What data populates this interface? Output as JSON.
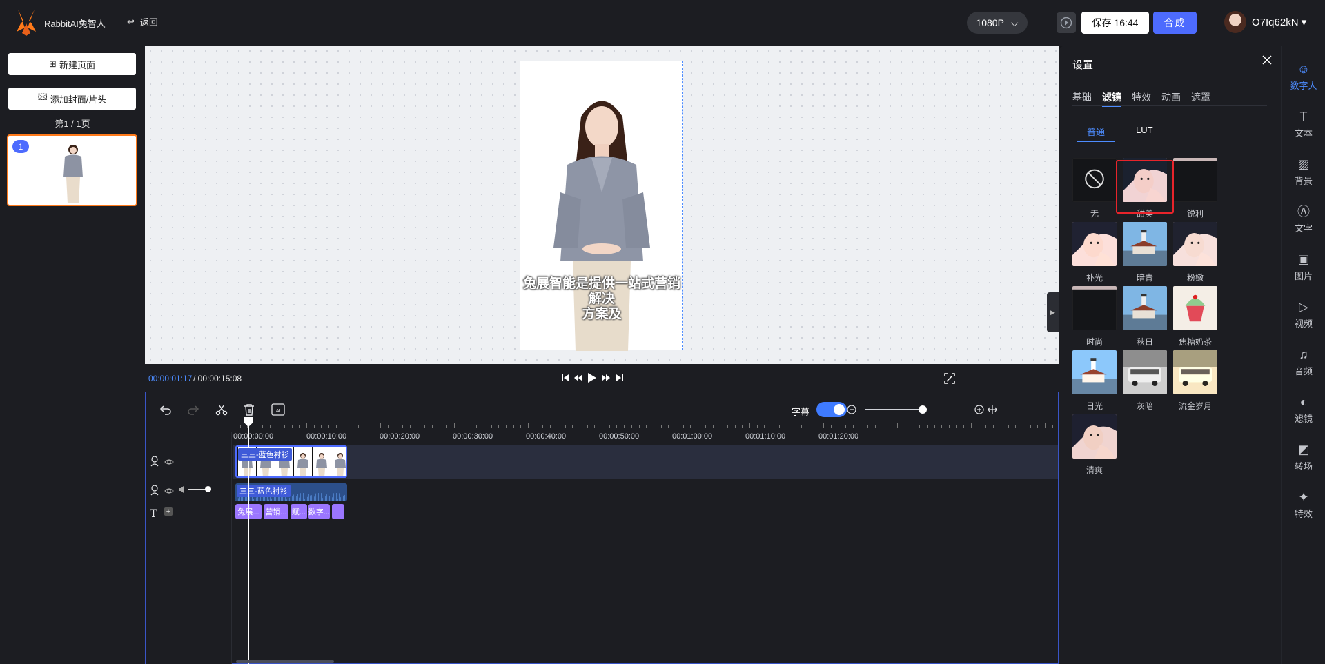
{
  "app": {
    "name": "RabbitAI兔智人",
    "back_label": "返回"
  },
  "topbar": {
    "resolution": "1080P",
    "save_label": "保存 16:44",
    "compose_label": "合成",
    "username": "O7Iq62kN"
  },
  "left": {
    "new_page": "新建页面",
    "add_cover": "添加封面/片头",
    "page_count": "第1 / 1页",
    "page_badge": "1"
  },
  "canvas": {
    "subtitle_line1": "兔展智能是提供一站式营销解决",
    "subtitle_line2": "方案及"
  },
  "player": {
    "current_time": "00:00:01:17",
    "total_time": "/ 00:00:15:08"
  },
  "timeline": {
    "subtitle_toggle_label": "字幕",
    "subtitle_enabled": true,
    "zoom_level": 1.0,
    "ticks": [
      "00:00:00:00",
      "00:00:10:00",
      "00:00:20:00",
      "00:00:30:00",
      "00:00:40:00",
      "00:00:50:00",
      "00:01:00:00",
      "00:01:10:00",
      "00:01:20:00"
    ],
    "video_clip_label": "三三-蓝色衬衫",
    "audio_clip_label": "三三-蓝色衬衫",
    "subtitle_clips": [
      "兔展...",
      "营销...",
      "赋...",
      "数字...",
      ""
    ]
  },
  "settings": {
    "title": "设置",
    "tabs": [
      "基础",
      "滤镜",
      "特效",
      "动画",
      "遮罩"
    ],
    "active_tab": "滤镜",
    "subtabs": [
      "普通",
      "LUT"
    ],
    "active_subtab": "普通",
    "filters": [
      "无",
      "甜美",
      "锐利",
      "补光",
      "暗青",
      "粉嫩",
      "时尚",
      "秋日",
      "焦糖奶茶",
      "日光",
      "灰暗",
      "流金岁月",
      "清爽"
    ],
    "selected_filter": "甜美"
  },
  "rail": [
    "数字人",
    "文本",
    "背景",
    "文字",
    "图片",
    "视频",
    "音频",
    "滤镜",
    "转场",
    "特效"
  ],
  "rail_icons": [
    "digital-human-icon",
    "text-icon",
    "background-icon",
    "font-icon",
    "image-icon",
    "video-icon",
    "audio-icon",
    "filter-icon",
    "transition-icon",
    "effect-icon"
  ],
  "colors": {
    "accent": "#4d6bfe",
    "link_blue": "#4d8cff",
    "selection_red": "#e8242b",
    "page_border": "#ff7a1a"
  }
}
